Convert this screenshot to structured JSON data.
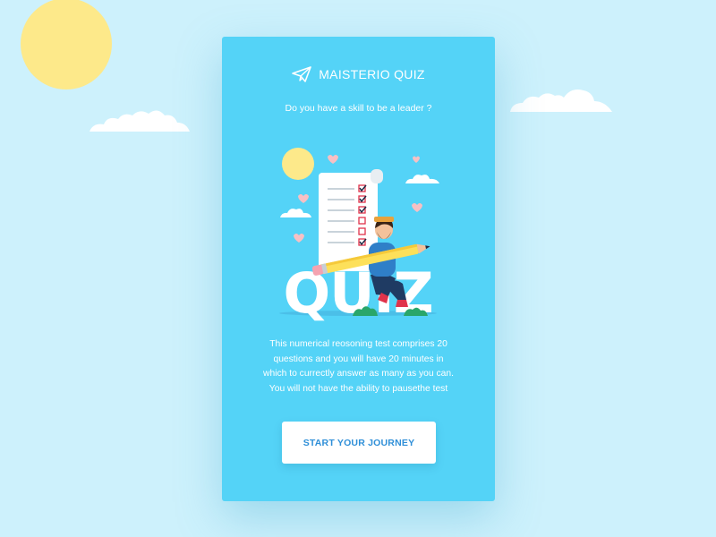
{
  "app": {
    "brand_name": "MAISTERIO QUIZ",
    "brand_icon": "paper-plane-icon"
  },
  "quiz": {
    "question": "Do you have a skill to be a leader ?",
    "illustration_word": "QUIZ",
    "description_lines": [
      "This numerical reosoning test comprises 20",
      "questions and you will have 20 minutes in",
      "which to currectly answer as many as you can.",
      "You will not have the ability to pausethe test"
    ]
  },
  "cta": {
    "label": "START YOUR JOURNEY"
  },
  "colors": {
    "background": "#cdf1fc",
    "card": "#54d3f7",
    "sun": "#fde98a",
    "button_text": "#2f8fd8"
  }
}
